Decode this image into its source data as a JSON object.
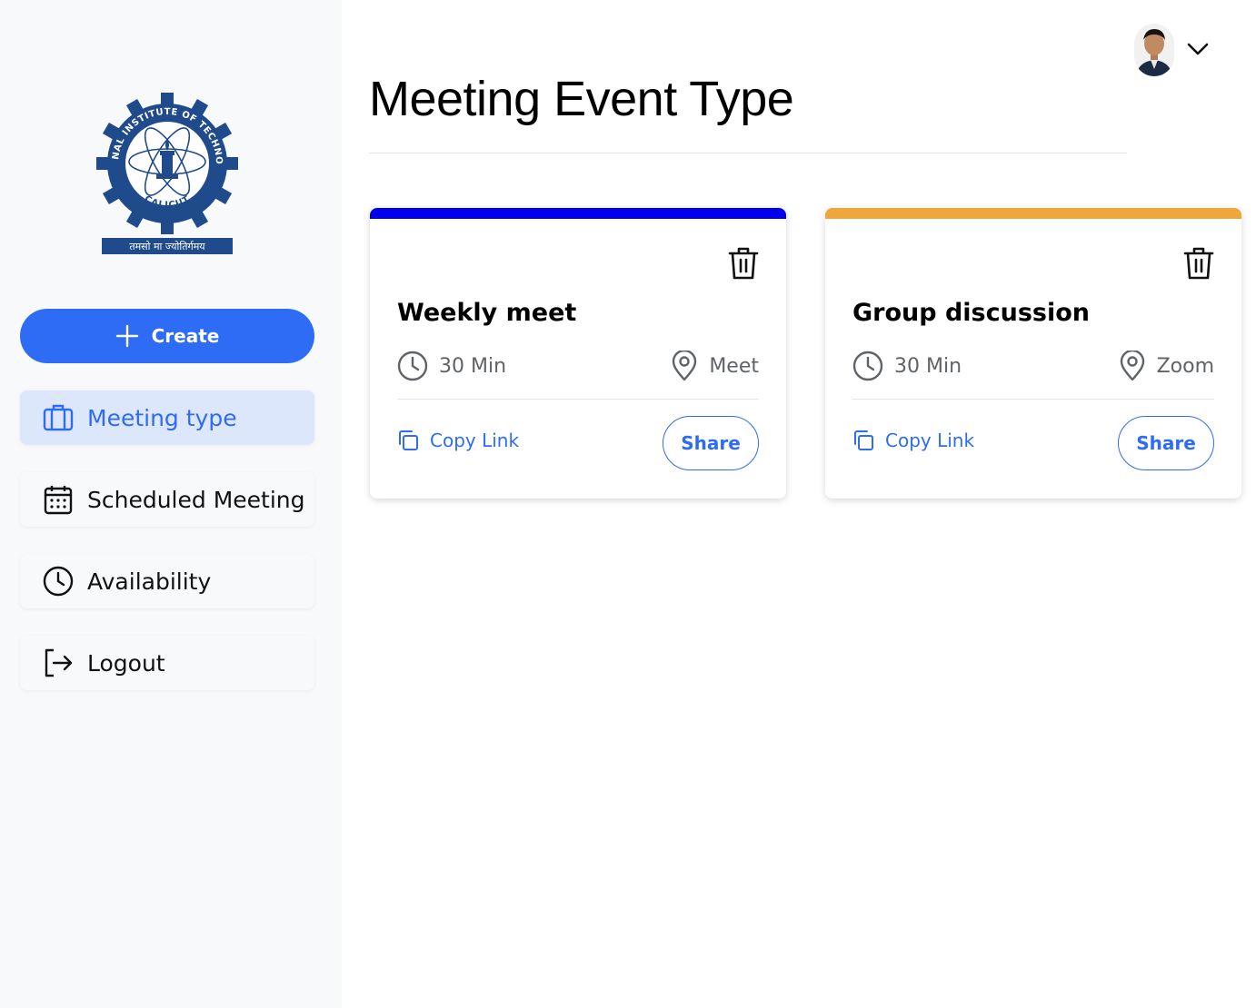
{
  "sidebar": {
    "logo": {
      "ring_text": "NATIONAL INSTITUTE OF TECHNOLOGY",
      "bottom_text": "CALICUT",
      "motto": "तमसो मा ज्योतिर्गमय",
      "color": "#1f4a8c"
    },
    "create_label": "Create",
    "items": [
      {
        "label": "Meeting type",
        "icon": "briefcase-icon",
        "active": true
      },
      {
        "label": "Scheduled Meeting",
        "icon": "calendar-icon",
        "active": false
      },
      {
        "label": "Availability",
        "icon": "clock-icon",
        "active": false
      },
      {
        "label": "Logout",
        "icon": "logout-icon",
        "active": false
      }
    ]
  },
  "header": {
    "title": "Meeting Event Type",
    "avatar_icon": "user-avatar",
    "menu_icon": "chevron-down-icon"
  },
  "cards": [
    {
      "name": "Weekly meet",
      "duration": "30 Min",
      "location": "Meet",
      "copy_label": "Copy Link",
      "share_label": "Share",
      "accent": "#0000ee"
    },
    {
      "name": "Group discussion",
      "duration": "30 Min",
      "location": "Zoom",
      "copy_label": "Copy Link",
      "share_label": "Share",
      "accent": "#f0a63a"
    }
  ],
  "colors": {
    "primary": "#2f6cf6",
    "active_bg": "#dde7fb",
    "sidebar_bg": "#f8f9fb"
  }
}
